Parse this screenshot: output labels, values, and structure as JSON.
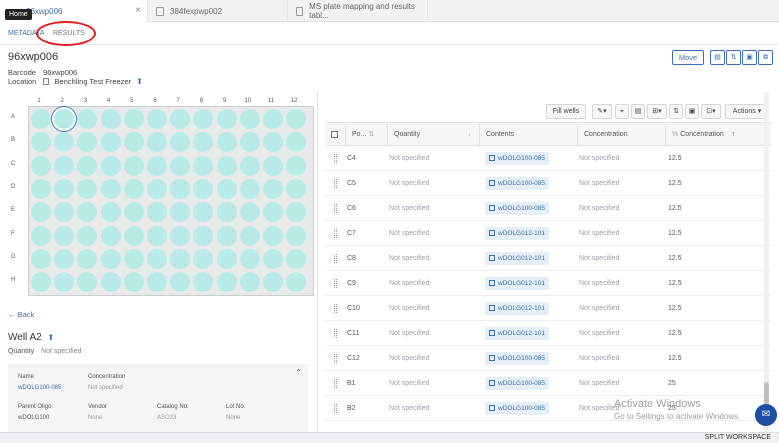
{
  "tabs": [
    {
      "label": "96xwp006"
    },
    {
      "label": "384fexpwp002"
    },
    {
      "label": "MS plate mapping and results tabl..."
    }
  ],
  "tooltip": "Home",
  "subnav": {
    "metadata": "METADATA",
    "results": "RESULTS"
  },
  "header": {
    "title": "96xwp006",
    "barcode_label": "Barcode",
    "barcode_value": "96xwp006",
    "location_label": "Location",
    "location_value": "Benchling Test Freezer",
    "move_label": "Move"
  },
  "plate": {
    "columns": [
      "1",
      "2",
      "3",
      "4",
      "5",
      "6",
      "7",
      "8",
      "9",
      "10",
      "11",
      "12"
    ],
    "rows": [
      "A",
      "B",
      "C",
      "D",
      "E",
      "F",
      "G",
      "H"
    ],
    "selected_well": "A2",
    "well_color": "#b9ebe6"
  },
  "left": {
    "back_label": "Back",
    "well_title": "Well A2",
    "quantity_label": "Quantity",
    "quantity_value": "Not specified",
    "card": {
      "name_label": "Name",
      "name_value": "wDOLG100-085",
      "conc_label": "Concentration",
      "conc_value": "Not specified",
      "parent_label": "Parent Oligo",
      "parent_value": "wDOLG100",
      "vendor_label": "Vendor",
      "vendor_value": "None",
      "catalog_label": "Catalog No.",
      "catalog_value": "ASO33",
      "lot_label": "Lot No.",
      "lot_value": "None"
    }
  },
  "toolbar": {
    "fill_wells": "Fill wells",
    "actions": "Actions"
  },
  "table": {
    "headers": {
      "position": "Po...",
      "quantity": "Quantity",
      "contents": "Contents",
      "concentration": "Concentration",
      "concentration2": "Concentration"
    },
    "rows": [
      {
        "pos": "C4",
        "qty": "Not specified",
        "contents": "wDOLG100-085",
        "conc": "Not specified",
        "conc2": "12.5"
      },
      {
        "pos": "C5",
        "qty": "Not specified",
        "contents": "wDOLG100-085",
        "conc": "Not specified",
        "conc2": "12.5"
      },
      {
        "pos": "C6",
        "qty": "Not specified",
        "contents": "wDOLG100-085",
        "conc": "Not specified",
        "conc2": "12.5"
      },
      {
        "pos": "C7",
        "qty": "Not specified",
        "contents": "wDOLG012-101",
        "conc": "Not specified",
        "conc2": "12.5"
      },
      {
        "pos": "C8",
        "qty": "Not specified",
        "contents": "wDOLG012-101",
        "conc": "Not specified",
        "conc2": "12.5"
      },
      {
        "pos": "C9",
        "qty": "Not specified",
        "contents": "wDOLG012-101",
        "conc": "Not specified",
        "conc2": "12.5"
      },
      {
        "pos": "C10",
        "qty": "Not specified",
        "contents": "wDOLG012-101",
        "conc": "Not specified",
        "conc2": "12.5"
      },
      {
        "pos": "C11",
        "qty": "Not specified",
        "contents": "wDOLG012-101",
        "conc": "Not specified",
        "conc2": "12.5"
      },
      {
        "pos": "C12",
        "qty": "Not specified",
        "contents": "wDOLG100-085",
        "conc": "Not specified",
        "conc2": "12.5"
      },
      {
        "pos": "B1",
        "qty": "Not specified",
        "contents": "wDOLG100-085",
        "conc": "Not specified",
        "conc2": "25"
      },
      {
        "pos": "B2",
        "qty": "Not specified",
        "contents": "wDOLG100-085",
        "conc": "Not specified",
        "conc2": "25"
      }
    ]
  },
  "footer": {
    "split": "SPLIT WORKSPACE"
  },
  "watermark": {
    "line1": "Activate Windows",
    "line2": "Go to Settings to activate Windows."
  }
}
